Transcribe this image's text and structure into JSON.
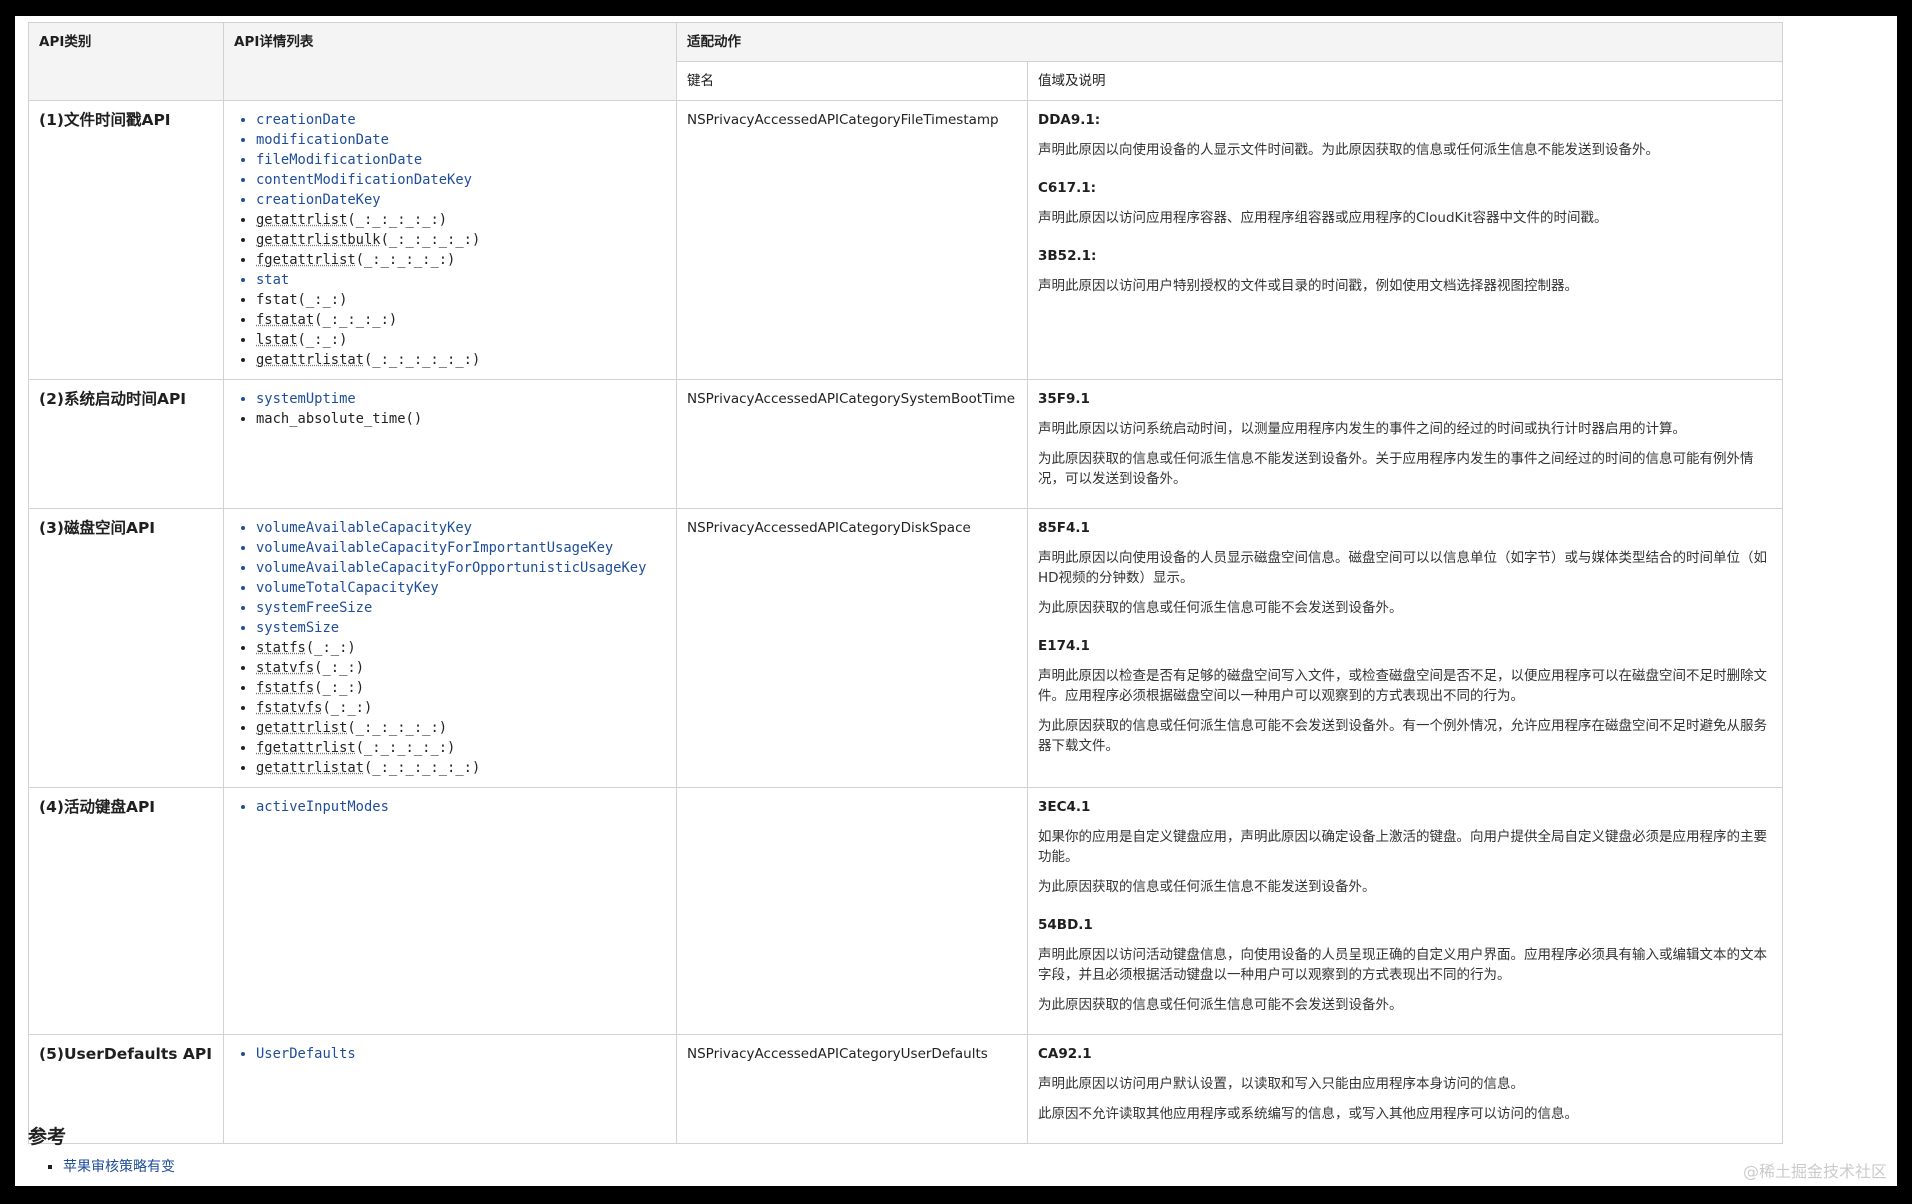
{
  "table": {
    "headers": {
      "category": "API类别",
      "api_list": "API详情列表",
      "action": "适配动作",
      "key": "键名",
      "values": "值域及说明"
    },
    "rows": [
      {
        "category": "(1)文件时间戳API",
        "apis": [
          {
            "name": "creationDate",
            "style": "link"
          },
          {
            "name": "modificationDate",
            "style": "link"
          },
          {
            "name": "fileModificationDate",
            "style": "link"
          },
          {
            "name": "contentModificationDateKey",
            "style": "link"
          },
          {
            "name": "creationDateKey",
            "style": "link"
          },
          {
            "name": "getattrlist",
            "suffix": "(_:_:_:_:_:)",
            "style": "dotted"
          },
          {
            "name": "getattrlistbulk",
            "suffix": "(_:_:_:_:_:)",
            "style": "dotted"
          },
          {
            "name": "fgetattrlist",
            "suffix": "(_:_:_:_:_:)",
            "style": "dotted"
          },
          {
            "name": "stat",
            "style": "link"
          },
          {
            "name": "fstat(_:_:)",
            "style": "plain"
          },
          {
            "name": "fstatat",
            "suffix": "(_:_:_:_:)",
            "style": "dotted"
          },
          {
            "name": "lstat",
            "suffix": "(_:_:)",
            "style": "dotted"
          },
          {
            "name": "getattrlistat",
            "suffix": "(_:_:_:_:_:_:)",
            "style": "dotted"
          }
        ],
        "key": "NSPrivacyAccessedAPICategoryFileTimestamp",
        "reasons": [
          {
            "code": "DDA9.1:",
            "paragraphs": [
              "声明此原因以向使用设备的人显示文件时间戳。为此原因获取的信息或任何派生信息不能发送到设备外。"
            ]
          },
          {
            "code": "C617.1:",
            "paragraphs": [
              "声明此原因以访问应用程序容器、应用程序组容器或应用程序的CloudKit容器中文件的时间戳。"
            ]
          },
          {
            "code": "3B52.1:",
            "paragraphs": [
              "声明此原因以访问用户特别授权的文件或目录的时间戳，例如使用文档选择器视图控制器。"
            ]
          }
        ]
      },
      {
        "category": "(2)系统启动时间API",
        "apis": [
          {
            "name": "systemUptime",
            "style": "link"
          },
          {
            "name": "mach_absolute_time()",
            "style": "plain"
          }
        ],
        "key": "NSPrivacyAccessedAPICategorySystemBootTime",
        "reasons": [
          {
            "code": "35F9.1",
            "paragraphs": [
              "声明此原因以访问系统启动时间，以测量应用程序内发生的事件之间的经过的时间或执行计时器启用的计算。",
              "为此原因获取的信息或任何派生信息不能发送到设备外。关于应用程序内发生的事件之间经过的时间的信息可能有例外情况，可以发送到设备外。"
            ]
          }
        ]
      },
      {
        "category": "(3)磁盘空间API",
        "apis": [
          {
            "name": "volumeAvailableCapacityKey",
            "style": "link"
          },
          {
            "name": "volumeAvailableCapacityForImportantUsageKey",
            "style": "link"
          },
          {
            "name": "volumeAvailableCapacityForOpportunisticUsageKey",
            "style": "link"
          },
          {
            "name": "volumeTotalCapacityKey",
            "style": "link"
          },
          {
            "name": "systemFreeSize",
            "style": "link"
          },
          {
            "name": "systemSize",
            "style": "link"
          },
          {
            "name": "statfs",
            "suffix": "(_:_:)",
            "style": "dotted"
          },
          {
            "name": "statvfs",
            "suffix": "(_:_:)",
            "style": "dotted"
          },
          {
            "name": "fstatfs",
            "suffix": "(_:_:)",
            "style": "dotted"
          },
          {
            "name": "fstatvfs",
            "suffix": "(_:_:)",
            "style": "dotted"
          },
          {
            "name": "getattrlist",
            "suffix": "(_:_:_:_:_:)",
            "style": "dotted"
          },
          {
            "name": "fgetattrlist",
            "suffix": "(_:_:_:_:_:)",
            "style": "dotted"
          },
          {
            "name": "getattrlistat",
            "suffix": "(_:_:_:_:_:_:)",
            "style": "dotted"
          }
        ],
        "key": "NSPrivacyAccessedAPICategoryDiskSpace",
        "reasons": [
          {
            "code": "85F4.1",
            "paragraphs": [
              "声明此原因以向使用设备的人员显示磁盘空间信息。磁盘空间可以以信息单位（如字节）或与媒体类型结合的时间单位（如HD视频的分钟数）显示。",
              "为此原因获取的信息或任何派生信息可能不会发送到设备外。"
            ]
          },
          {
            "code": "E174.1",
            "paragraphs": [
              "声明此原因以检查是否有足够的磁盘空间写入文件，或检查磁盘空间是否不足，以便应用程序可以在磁盘空间不足时删除文件。应用程序必须根据磁盘空间以一种用户可以观察到的方式表现出不同的行为。",
              "为此原因获取的信息或任何派生信息可能不会发送到设备外。有一个例外情况，允许应用程序在磁盘空间不足时避免从服务器下载文件。"
            ]
          }
        ]
      },
      {
        "category": "(4)活动键盘API",
        "apis": [
          {
            "name": "activeInputModes",
            "style": "link"
          }
        ],
        "key": "",
        "reasons": [
          {
            "code": "3EC4.1",
            "paragraphs": [
              "如果你的应用是自定义键盘应用，声明此原因以确定设备上激活的键盘。向用户提供全局自定义键盘必须是应用程序的主要功能。",
              "为此原因获取的信息或任何派生信息不能发送到设备外。"
            ]
          },
          {
            "code": "54BD.1",
            "paragraphs": [
              "声明此原因以访问活动键盘信息，向使用设备的人员呈现正确的自定义用户界面。应用程序必须具有输入或编辑文本的文本字段，并且必须根据活动键盘以一种用户可以观察到的方式表现出不同的行为。",
              "为此原因获取的信息或任何派生信息可能不会发送到设备外。"
            ]
          }
        ]
      },
      {
        "category": "(5)UserDefaults API",
        "apis": [
          {
            "name": "UserDefaults",
            "style": "link"
          }
        ],
        "key": "NSPrivacyAccessedAPICategoryUserDefaults",
        "reasons": [
          {
            "code": "CA92.1",
            "paragraphs": [
              "声明此原因以访问用户默认设置，以读取和写入只能由应用程序本身访问的信息。",
              "此原因不允许读取其他应用程序或系统编写的信息，或写入其他应用程序可以访问的信息。"
            ]
          }
        ]
      }
    ]
  },
  "references": {
    "title": "参考",
    "links": [
      "苹果审核策略有变"
    ]
  },
  "watermark": "@稀土掘金技术社区",
  "colors": {
    "link": "#1f4e99",
    "header_bg": "#f4f4f4",
    "border": "#d2d2d2"
  }
}
